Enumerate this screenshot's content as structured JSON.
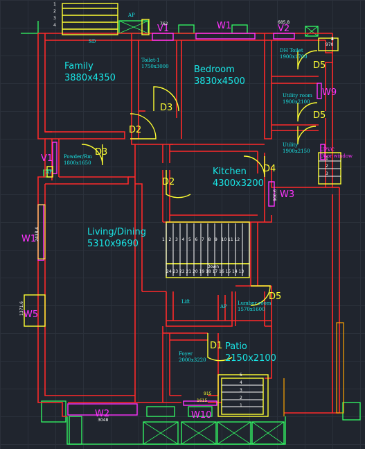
{
  "colors": {
    "background": "#20252e",
    "wall": "#ff2a2a",
    "door": "#ffff33",
    "window": "#ff33ff",
    "label": "#19e6e6",
    "outline": "#33ff66",
    "stair": "#ffffff",
    "furniture": "#ffa500"
  },
  "rooms": {
    "family": {
      "name": "Family",
      "size": "3880x4350"
    },
    "bedroom": {
      "name": "Bedroom",
      "size": "3830x4500"
    },
    "kitchen": {
      "name": "Kitchen",
      "size": "4300x3200"
    },
    "living": {
      "name": "Living/Dining",
      "size": "5310x9690"
    },
    "patio": {
      "name": "Patio",
      "size": "2150x2100"
    }
  },
  "small_rooms": {
    "toilet1": {
      "name": "Toilet-1",
      "size": "1750x3000"
    },
    "dh_toilet": {
      "name": "DH Toilet",
      "size": "1900x1700"
    },
    "utility_room": {
      "name": "Utility room",
      "size": "1900x2100"
    },
    "utility": {
      "name": "Utility",
      "size": "1900x2150"
    },
    "powder": {
      "name": "Powder/Rm",
      "size": "1800x1650"
    },
    "lumber": {
      "name": "Lumber room",
      "size": "1570x1600"
    },
    "foyer": {
      "name": "Foyer",
      "size": "2000x3220"
    },
    "lift": "Lift",
    "ap_mid": "AP",
    "ap_top": "AP",
    "ap_left": "AP",
    "sd": "SD",
    "upvc": "UPVC",
    "upvc2": "Door window",
    "down": "Down"
  },
  "doors": [
    "D1",
    "D2",
    "D2",
    "D3",
    "D3",
    "D4",
    "D5",
    "D5",
    "D5",
    "D5"
  ],
  "windows": [
    "V1",
    "V2",
    "V1",
    "W1",
    "W1",
    "W2",
    "W3",
    "W5",
    "W9",
    "W10"
  ],
  "dims": {
    "v1_top": "762",
    "v2_top": "685.8",
    "right_top": "970",
    "w3": "900.6",
    "w5": "1371.6",
    "w1_left": "2438.4",
    "w2": "3048",
    "w10": "1615",
    "w10b": "915"
  },
  "stair_steps_up": [
    "1",
    "2",
    "3",
    "4",
    "5",
    "6",
    "7",
    "8",
    "9",
    "10",
    "11",
    "12"
  ],
  "stair_steps_down": [
    "24",
    "23",
    "22",
    "21",
    "20",
    "19",
    "18",
    "17",
    "16",
    "15",
    "14",
    "13"
  ],
  "right_steps": [
    "1",
    "2",
    "3"
  ],
  "right_steps_b": [
    "1",
    "2",
    "3",
    "4"
  ],
  "patio_steps": [
    "5",
    "4",
    "3",
    "2",
    "1"
  ],
  "top_steps": [
    "1",
    "2",
    "3",
    "4"
  ]
}
